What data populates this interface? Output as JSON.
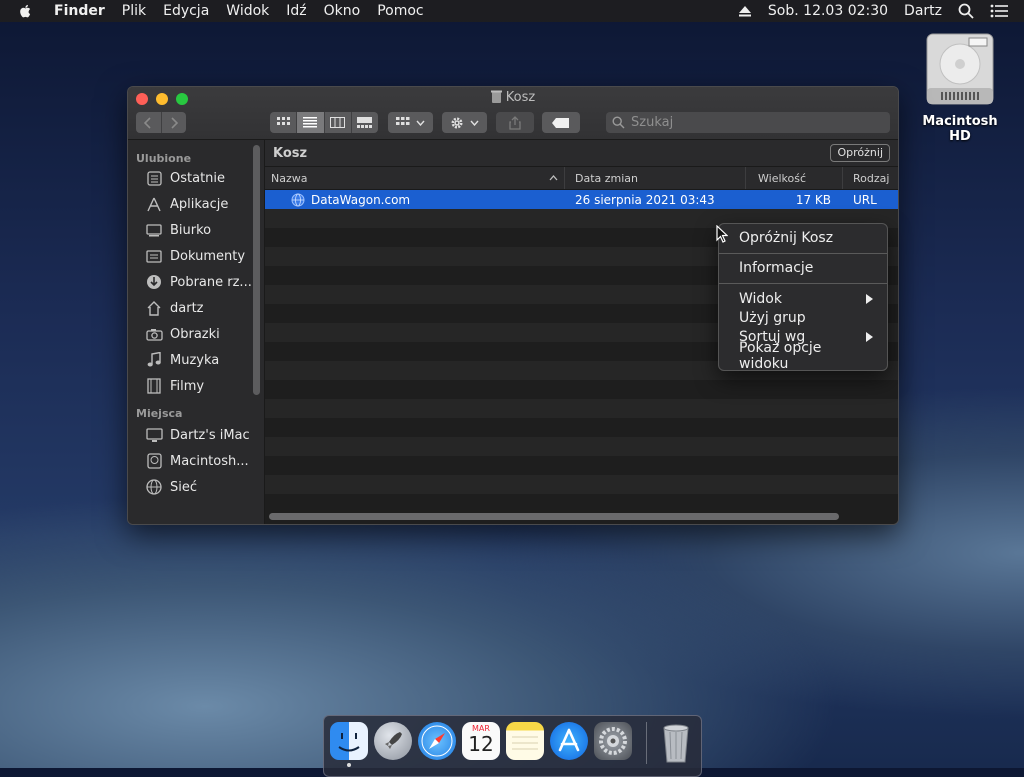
{
  "menubar": {
    "app": "Finder",
    "items": [
      "Plik",
      "Edycja",
      "Widok",
      "Idź",
      "Okno",
      "Pomoc"
    ],
    "datetime": "Sob. 12.03  02:30",
    "user": "Dartz"
  },
  "desktop": {
    "hd_label": "Macintosh HD"
  },
  "window": {
    "title": "Kosz",
    "search_placeholder": "Szukaj",
    "path": "Kosz",
    "empty_button": "Opróżnij",
    "sidebar": {
      "favorites_heading": "Ulubione",
      "favorites": [
        {
          "label": "Ostatnie"
        },
        {
          "label": "Aplikacje"
        },
        {
          "label": "Biurko"
        },
        {
          "label": "Dokumenty"
        },
        {
          "label": "Pobrane rz..."
        },
        {
          "label": "dartz"
        },
        {
          "label": "Obrazki"
        },
        {
          "label": "Muzyka"
        },
        {
          "label": "Filmy"
        }
      ],
      "places_heading": "Miejsca",
      "places": [
        {
          "label": "Dartz's iMac"
        },
        {
          "label": "Macintosh..."
        },
        {
          "label": "Sieć"
        }
      ]
    },
    "columns": {
      "name": "Nazwa",
      "date": "Data zmian",
      "size": "Wielkość",
      "kind": "Rodzaj"
    },
    "files": [
      {
        "name": "DataWagon.com",
        "date": "26 sierpnia 2021 03:43",
        "size": "17 KB",
        "kind": "URL"
      }
    ]
  },
  "context_menu": {
    "empty_trash": "Opróżnij Kosz",
    "info": "Informacje",
    "view": "Widok",
    "use_groups": "Użyj grup",
    "sort_by": "Sortuj wg",
    "view_options": "Pokaż opcje widoku"
  },
  "dock": {
    "calendar_month": "MAR",
    "calendar_day": "12"
  },
  "colors": {
    "selection": "#1b5fd0",
    "close": "#fe5f57",
    "minimize": "#febc2e",
    "zoom": "#28c840"
  }
}
